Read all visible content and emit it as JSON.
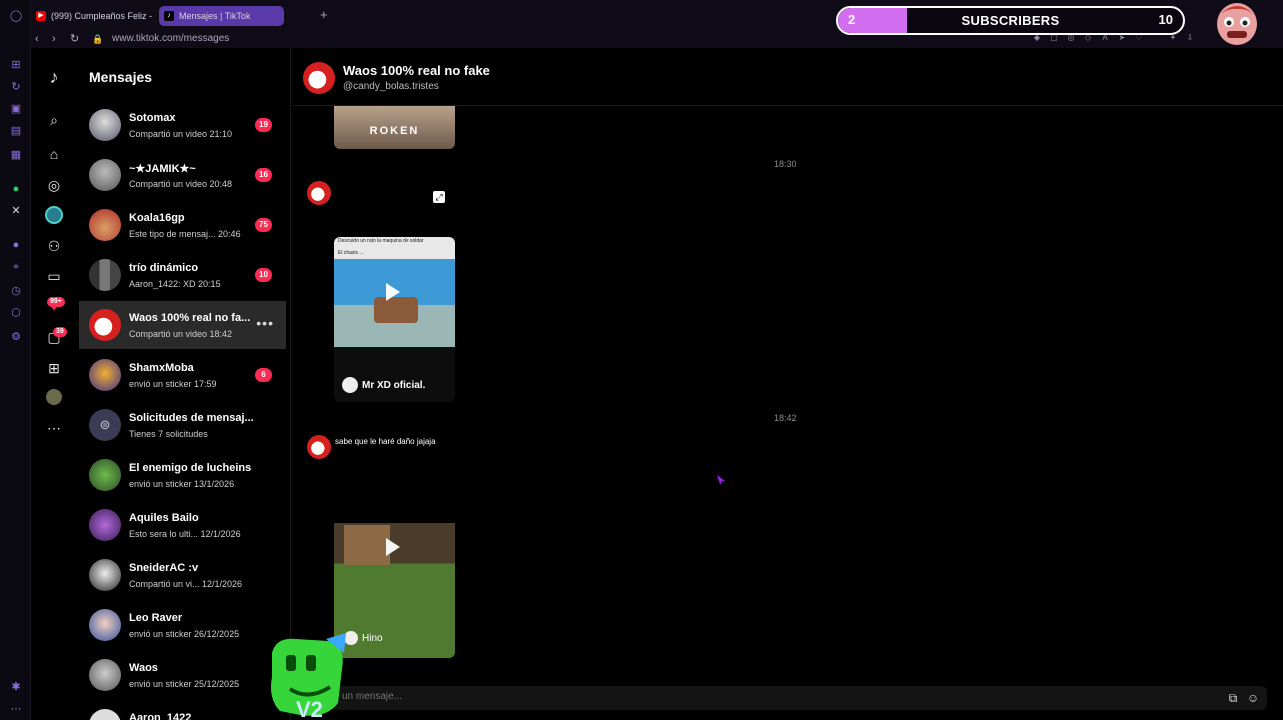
{
  "browser": {
    "tabs": [
      {
        "label": "(999) Cumpleaños Feliz - ",
        "icon": "youtube-icon"
      },
      {
        "label": "Mensajes | TikTok",
        "icon": "tiktok-icon"
      }
    ],
    "new_tab_label": "+",
    "url": "www.tiktok.com/messages"
  },
  "overlay": {
    "subscribers_current": "2",
    "subscribers_label": "SUBSCRIBERS",
    "subscribers_goal": "10",
    "progress_fraction": 0.2
  },
  "tiktok_rail": {
    "notifications_badge": "99+",
    "inbox_badge": "39"
  },
  "inbox": {
    "title": "Mensajes",
    "conversations": [
      {
        "name": "Sotomax",
        "sub": "Compartió un video 21:10",
        "badge": "19"
      },
      {
        "name": "~★JAMIK★~",
        "sub": "Compartió un video 20:48",
        "badge": "16"
      },
      {
        "name": "Koala16gp",
        "sub": "Este tipo de mensaj... 20:46",
        "badge": "75"
      },
      {
        "name": "trío dinámico",
        "sub": "Aaron_1422: XD 20:15",
        "badge": "10"
      },
      {
        "name": "Waos 100% real no fa...",
        "sub": "Compartió un video 18:42",
        "badge": ""
      },
      {
        "name": "ShamxMoba",
        "sub": "envió un sticker 17:59",
        "badge": "6"
      },
      {
        "name": "Solicitudes de mensaj...",
        "sub": "Tienes 7 solicitudes",
        "badge": ""
      },
      {
        "name": "El enemigo de lucheins",
        "sub": "envió un sticker 13/1/2026",
        "badge": ""
      },
      {
        "name": "Aquiles Bailo",
        "sub": "Esto sera lo ulti... 12/1/2026",
        "badge": ""
      },
      {
        "name": "SneiderAC :v",
        "sub": "Compartió un vi... 12/1/2026",
        "badge": ""
      },
      {
        "name": "Leo Raver",
        "sub": "envió un sticker 26/12/2025",
        "badge": ""
      },
      {
        "name": "Waos",
        "sub": "envió un sticker 25/12/2025",
        "badge": ""
      },
      {
        "name": "Aaron_1422",
        "sub": "",
        "badge": ""
      }
    ]
  },
  "chat": {
    "title": "Waos 100% real no fake",
    "handle": "@candy_bolas.tristes",
    "card1_caption": "ROKEN",
    "time1": "18:30",
    "card2_toptext": "Descuido un rato la maquina de soldar",
    "card2_toptext2": "El chasis ...",
    "card2_author": "Mr XD oficial.",
    "time2": "18:42",
    "card3_caption": "sabe que le haré daño jajaja",
    "card3_author": "Hino",
    "input_placeholder": "un mensaje..."
  },
  "colors": {
    "accent": "#fe2c55",
    "active_row": "#2a2a2a",
    "progress_fill": "#d46ef0"
  }
}
